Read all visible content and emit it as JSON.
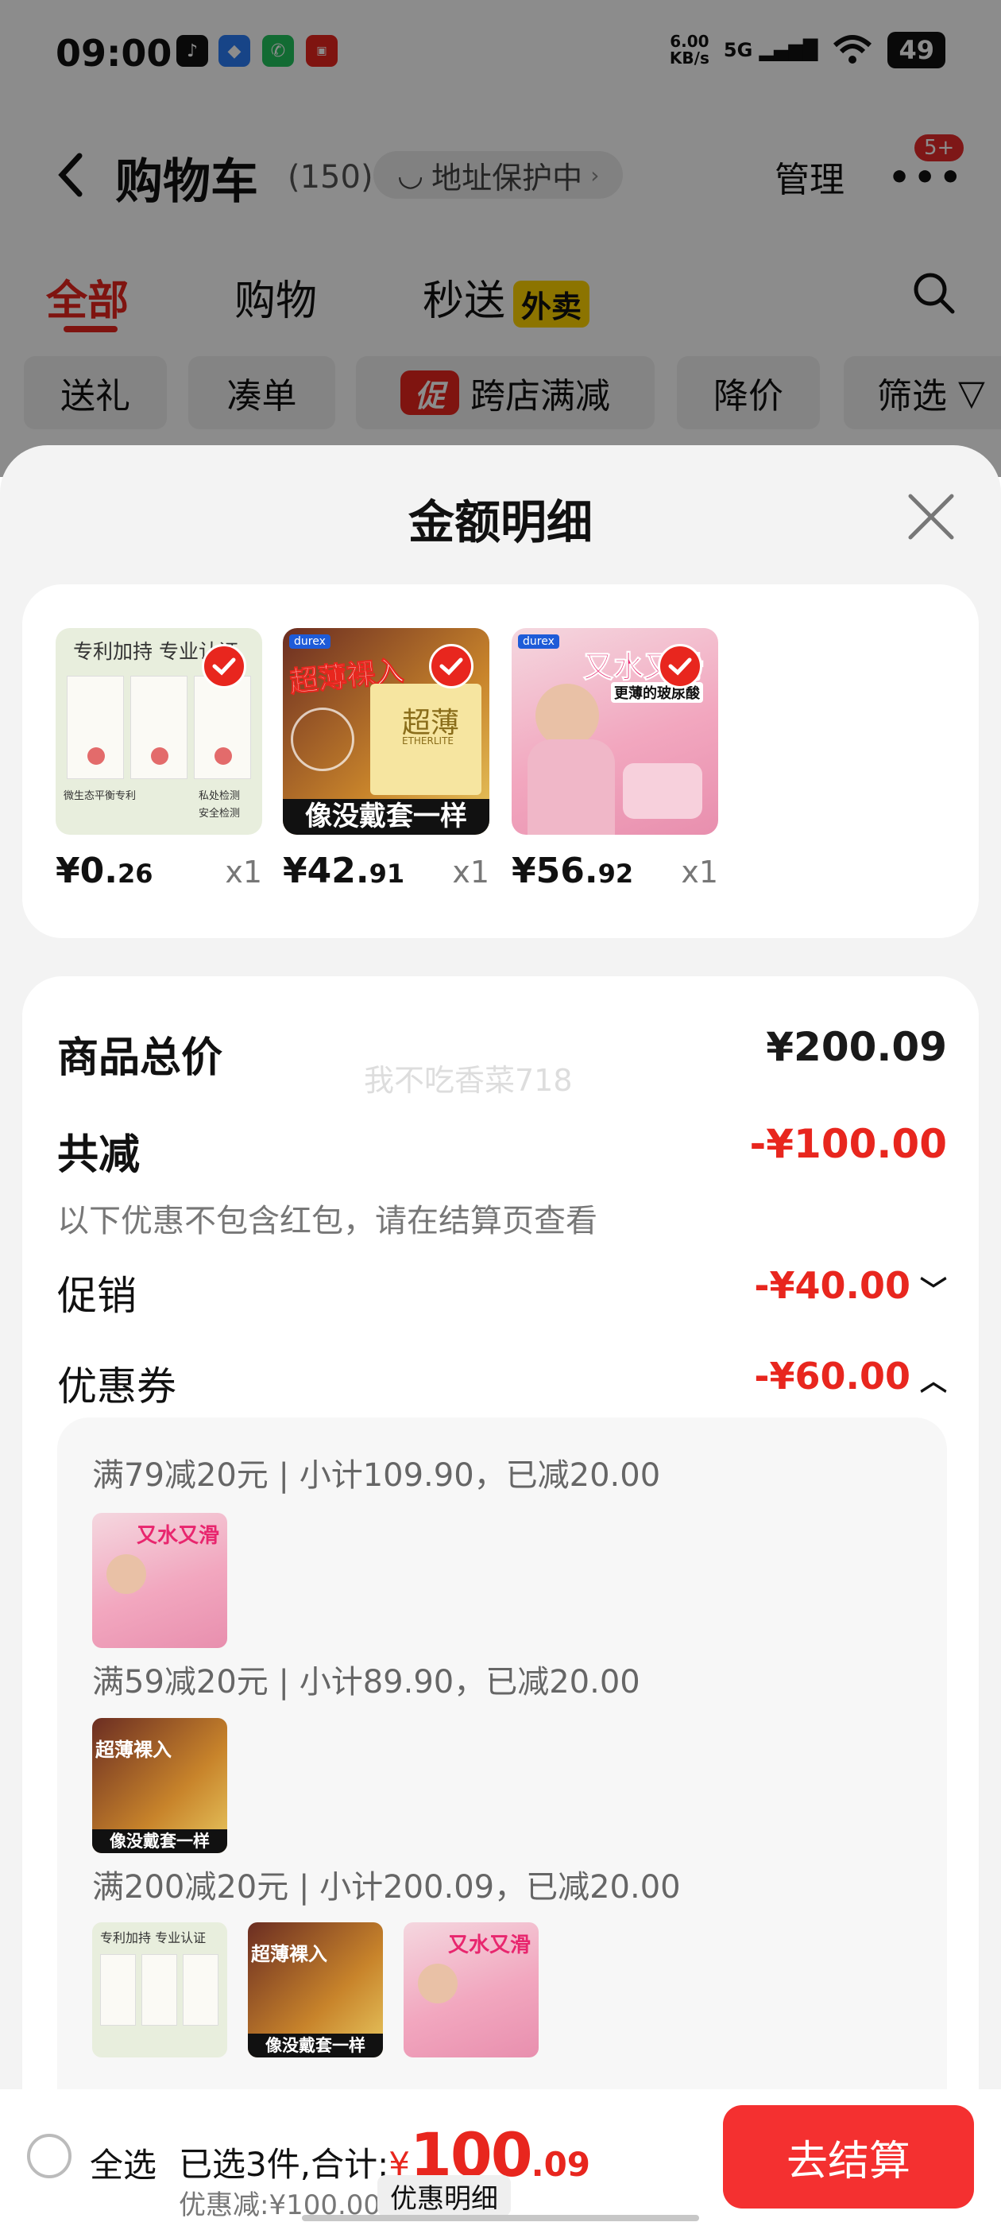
{
  "status_bar": {
    "time": "09:00",
    "net_speed_value": "6.00",
    "net_speed_unit": "KB/s",
    "signal": "5G",
    "battery": "49"
  },
  "header": {
    "title": "购物车",
    "count": "(150)",
    "address_protect": "地址保护中",
    "manage": "管理",
    "more_badge": "5+"
  },
  "tabs": [
    {
      "label": "全部"
    },
    {
      "label": "购物"
    },
    {
      "label": "秒送"
    }
  ],
  "waimai_badge": "外卖",
  "filters": {
    "gift": "送礼",
    "bundle": "凑单",
    "promo_tag": "促",
    "cross_store": "跨店满减",
    "price_drop": "降价",
    "filter": "筛选"
  },
  "sheet": {
    "title": "金额明细",
    "products": [
      {
        "price_int": "¥0.",
        "price_dec": "26",
        "qty": "x1",
        "img_text": "专利加持 专业认证",
        "cert1": "微生态平衡专利",
        "cert2": "私处检测",
        "cert3": "安全检测"
      },
      {
        "price_int": "¥42.",
        "price_dec": "91",
        "qty": "x1",
        "img_top": "超薄裸入",
        "img_bottom": "像没戴套一样",
        "box_text": "超薄",
        "brand": "durex",
        "sub": "ETHERLITE"
      },
      {
        "price_int": "¥56.",
        "price_dec": "92",
        "qty": "x1",
        "img_top": "又水又滑",
        "img_sub": "更薄的玻尿酸",
        "brand": "durex"
      }
    ],
    "total_label": "商品总价",
    "total_value": "¥200.09",
    "watermark": "我不吃香菜718",
    "reduce_label": "共减",
    "reduce_value": "-¥100.00",
    "reduce_note": "以下优惠不包含红包，请在结算页查看",
    "promo_label": "促销",
    "promo_value": "-¥40.00",
    "coupon_label": "优惠券",
    "coupon_value": "-¥60.00",
    "coupon_lines": [
      "满79减20元 | 小计109.90，已减20.00",
      "满59减20元 | 小计89.90，已减20.00",
      "满200减20元 | 小计200.09，已减20.00"
    ]
  },
  "bottom": {
    "select_all": "全选",
    "selected": "已选3件,合计:",
    "currency": "¥",
    "amount": "100",
    "cents": ".09",
    "discount": "优惠减:¥100.00",
    "detail_btn": "优惠明细",
    "checkout": "去结算"
  },
  "colors": {
    "accent": "#e8261e",
    "checkout": "#f43030",
    "waimai": "#ffd400"
  }
}
